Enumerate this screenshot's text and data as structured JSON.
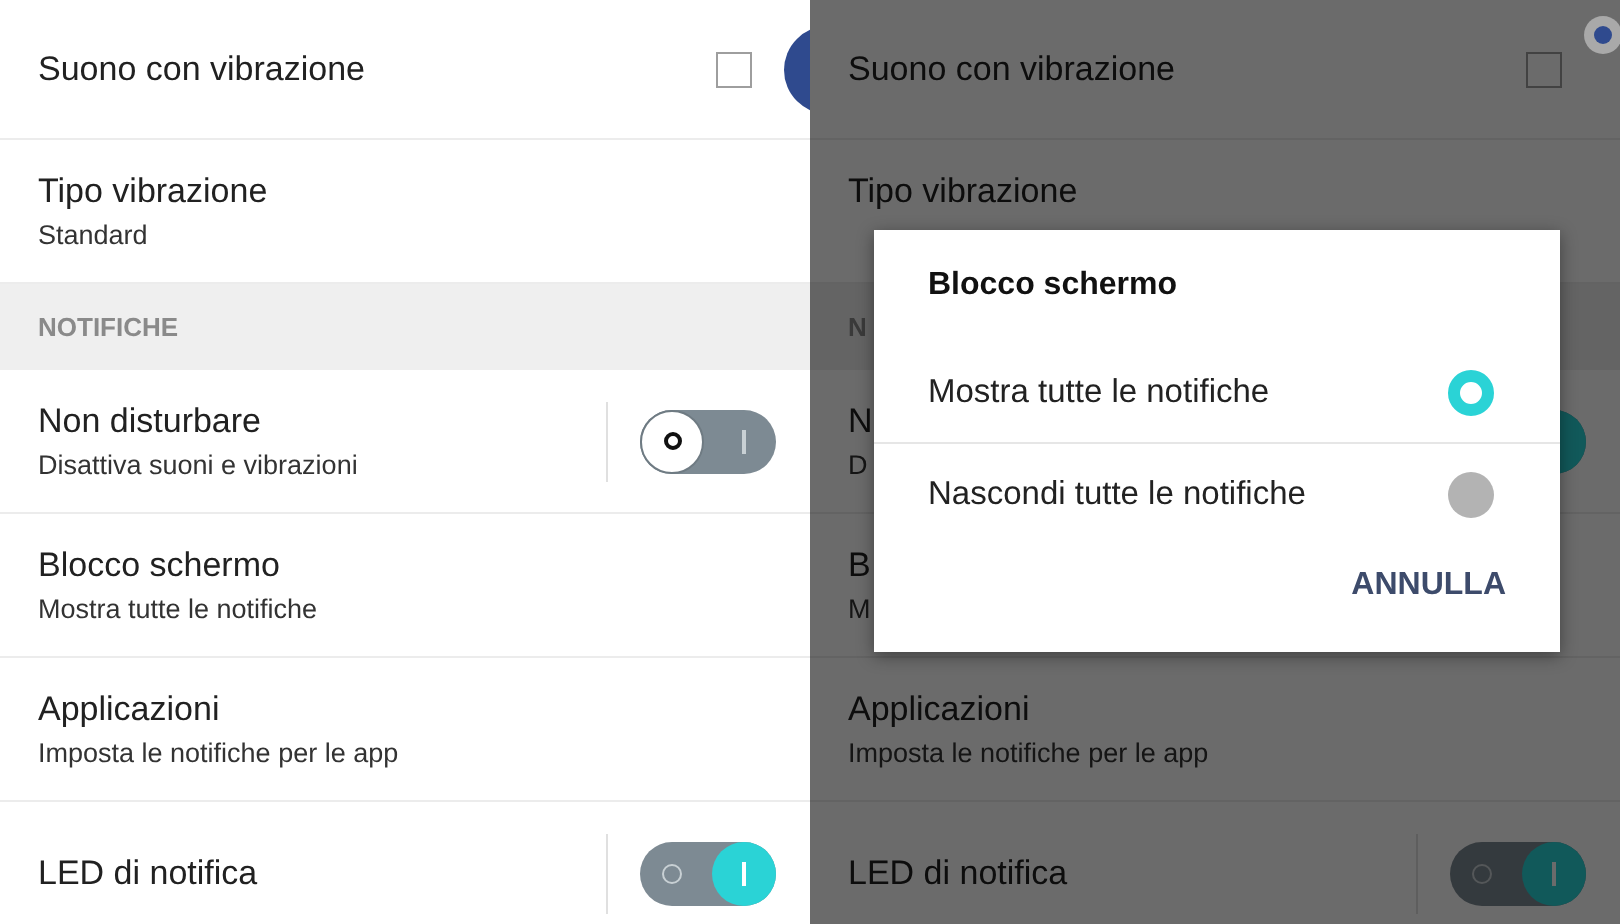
{
  "panels": [
    {
      "dimmed": false,
      "items": [
        {
          "kind": "checkbox",
          "title": "Suono con vibrazione",
          "checked": false
        },
        {
          "kind": "detail",
          "title": "Tipo vibrazione",
          "subtitle": "Standard"
        },
        {
          "kind": "header",
          "title": "NOTIFICHE"
        },
        {
          "kind": "toggle",
          "title": "Non disturbare",
          "subtitle": "Disattiva suoni e vibrazioni",
          "on": false
        },
        {
          "kind": "detail",
          "title": "Blocco schermo",
          "subtitle": "Mostra tutte le notifiche"
        },
        {
          "kind": "detail",
          "title": "Applicazioni",
          "subtitle": "Imposta le notifiche per le app"
        },
        {
          "kind": "toggle",
          "title": "LED di notifica",
          "on": true
        }
      ]
    },
    {
      "dimmed": true,
      "items": [
        {
          "kind": "checkbox",
          "title": "Suono con vibrazione",
          "checked": false
        },
        {
          "kind": "detail",
          "title": "Tipo vibrazione"
        },
        {
          "kind": "header",
          "title": "N"
        },
        {
          "kind": "toggle",
          "title": "N",
          "subtitle": "D",
          "on": true
        },
        {
          "kind": "detail",
          "title": "B",
          "subtitle": "M"
        },
        {
          "kind": "detail",
          "title": "Applicazioni",
          "subtitle": "Imposta le notifiche per le app"
        },
        {
          "kind": "toggle",
          "title": "LED di notifica",
          "on": true
        }
      ],
      "dialog": {
        "title": "Blocco schermo",
        "options": [
          {
            "label": "Mostra tutte le notifiche",
            "selected": true
          },
          {
            "label": "Nascondi tutte le notifiche",
            "selected": false
          }
        ],
        "buttons": [
          "ANNULLA"
        ]
      }
    }
  ]
}
